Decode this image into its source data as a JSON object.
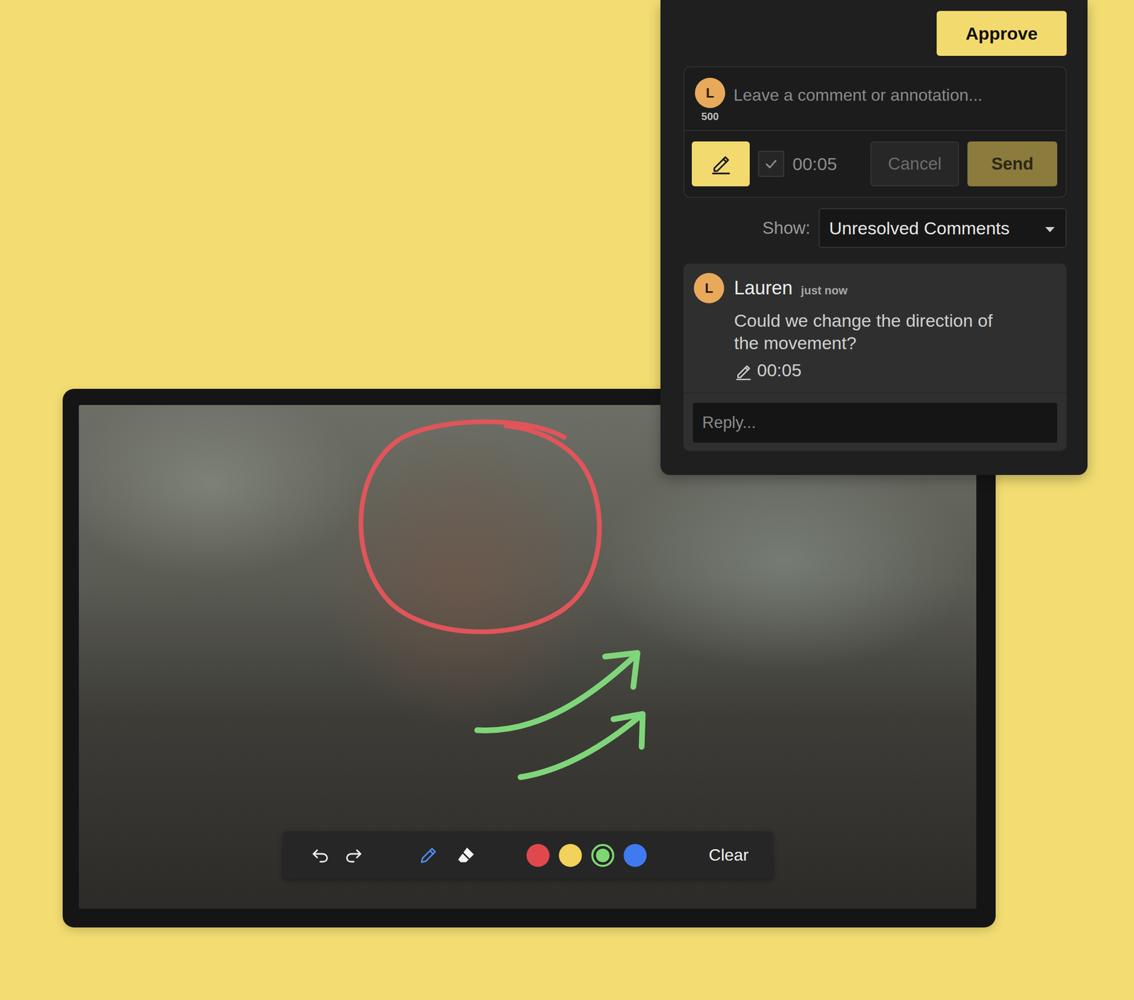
{
  "panel": {
    "approve": "Approve",
    "composer": {
      "avatar": "L",
      "count": "500",
      "placeholder": "Leave a comment or annotation...",
      "draw_active": true,
      "timestamp_checked": true,
      "timestamp": "00:05",
      "cancel": "Cancel",
      "cancel_disabled": true,
      "send": "Send",
      "send_disabled": true
    },
    "filter": {
      "label": "Show:",
      "value": "Unresolved Comments"
    },
    "comments": [
      {
        "avatar": "L",
        "author": "Lauren",
        "time": "just now",
        "text": "Could we change the direction of the movement?",
        "timestamp": "00:05"
      }
    ],
    "reply_placeholder": "Reply..."
  },
  "player": {
    "annotations": [
      {
        "kind": "circle",
        "color": "#e0555a"
      },
      {
        "kind": "arrow",
        "color": "#7fd67a"
      },
      {
        "kind": "arrow",
        "color": "#7fd67a"
      }
    ],
    "tools": [
      {
        "kind": "pen",
        "selected": true
      },
      {
        "kind": "eraser",
        "selected": false
      }
    ],
    "swatches": [
      {
        "color": "#e0484e",
        "selected": false
      },
      {
        "color": "#f1d25a",
        "selected": false
      },
      {
        "color": "#7dd872",
        "selected": true
      },
      {
        "color": "#3f7bef",
        "selected": false
      }
    ],
    "clear": "Clear"
  }
}
